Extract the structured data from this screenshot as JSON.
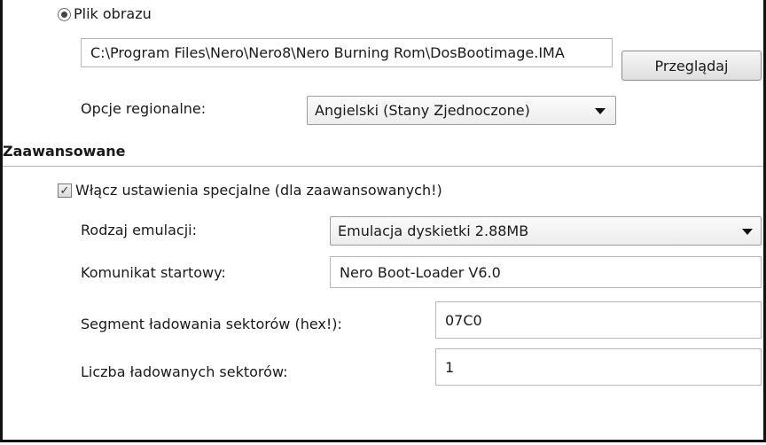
{
  "image_file": {
    "radio_label": "Plik obrazu",
    "path_value": "C:\\Program Files\\Nero\\Nero8\\Nero Burning Rom\\DosBootimage.IMA",
    "browse_button": "Przeglądaj"
  },
  "regional": {
    "label": "Opcje regionalne:",
    "selected": "Angielski (Stany Zjednoczone)"
  },
  "advanced": {
    "section_title": "Zaawansowane",
    "enable_checkbox_label": "Włącz ustawienia specjalne (dla zaawansowanych!)",
    "emulation_label": "Rodzaj emulacji:",
    "emulation_selected": "Emulacja dyskietki 2.88MB",
    "boot_message_label": "Komunikat startowy:",
    "boot_message_value": "Nero Boot-Loader V6.0",
    "load_segment_label": "Segment ładowania sektorów (hex!):",
    "load_segment_value": "07C0",
    "sector_count_label": "Liczba ładowanych sektorów:",
    "sector_count_value": "1"
  }
}
